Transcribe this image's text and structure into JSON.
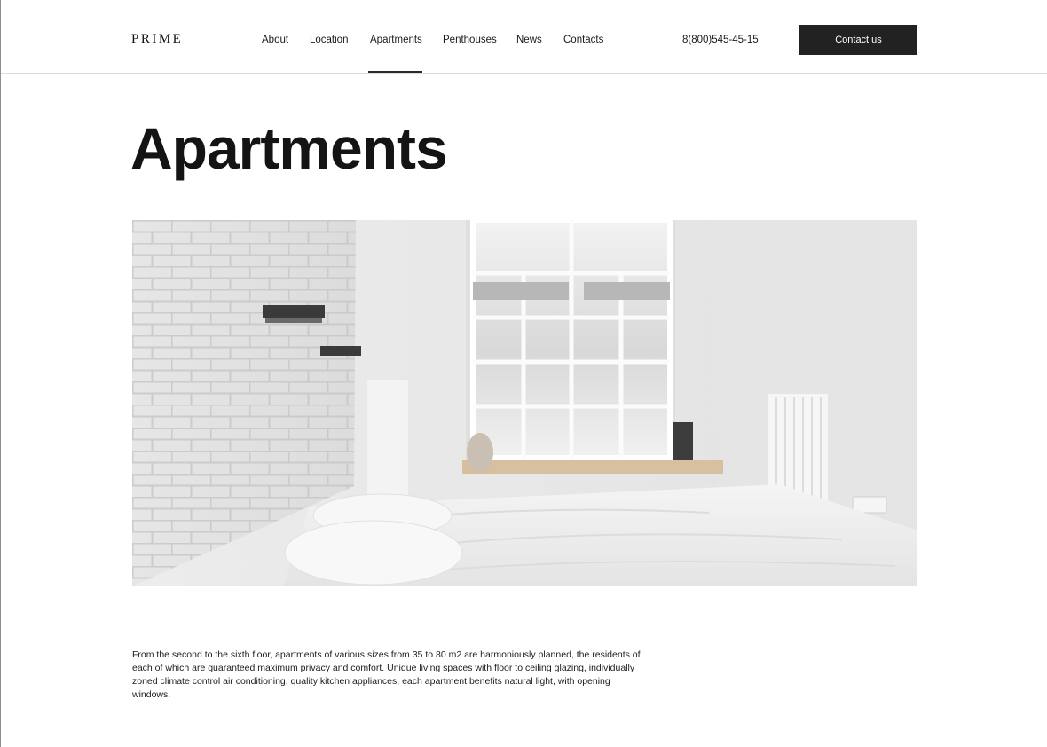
{
  "brand": {
    "logo": "PRIME"
  },
  "nav": {
    "items": [
      {
        "label": "About",
        "active": false
      },
      {
        "label": "Location",
        "active": false
      },
      {
        "label": "Apartments",
        "active": true
      },
      {
        "label": "Penthouses",
        "active": false
      },
      {
        "label": "News",
        "active": false
      },
      {
        "label": "Contacts",
        "active": false
      }
    ]
  },
  "header": {
    "phone": "8(800)545-45-15",
    "cta_label": "Contact us"
  },
  "main": {
    "title": "Apartments",
    "description": "From the second to the sixth floor, apartments of various sizes from 35 to 80 m2 are harmoniously planned, the residents of each of which are guaranteed maximum privacy and comfort.  Unique living spaces with floor to ceiling glazing, individually zoned climate control air conditioning, quality kitchen appliances, each apartment benefits natural light, with opening windows."
  },
  "colors": {
    "accent": "#222222",
    "text": "#1c1c1c",
    "divider": "#dcdcdc"
  }
}
